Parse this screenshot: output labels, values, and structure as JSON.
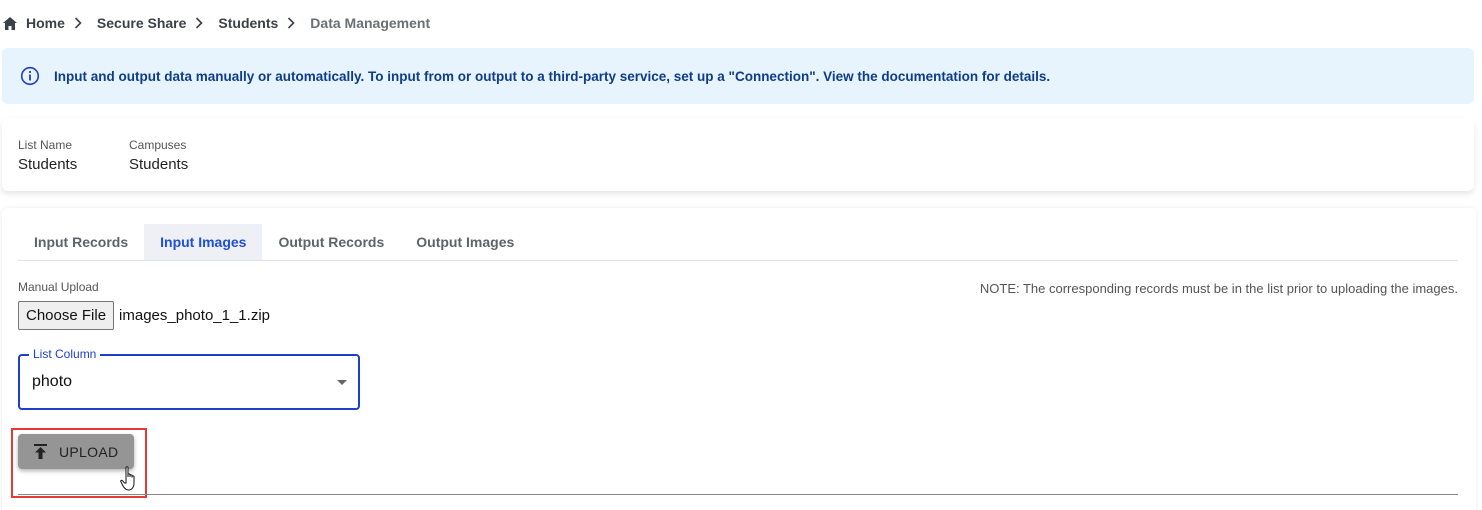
{
  "breadcrumb": {
    "items": [
      "Home",
      "Secure Share",
      "Students"
    ],
    "current": "Data Management"
  },
  "banner": {
    "text": "Input and output data manually or automatically. To input from or output to a third-party service, set up a \"Connection\". View the documentation for details."
  },
  "list_info": {
    "list_name_label": "List Name",
    "list_name_value": "Students",
    "campuses_label": "Campuses",
    "campuses_value": "Students"
  },
  "tabs": [
    {
      "label": "Input Records",
      "active": false
    },
    {
      "label": "Input Images",
      "active": true
    },
    {
      "label": "Output Records",
      "active": false
    },
    {
      "label": "Output Images",
      "active": false
    }
  ],
  "upload": {
    "manual_label": "Manual Upload",
    "note": "NOTE: The corresponding records must be in the list prior to uploading the images.",
    "choose_file_label": "Choose File",
    "file_name": "images_photo_1_1.zip",
    "list_column_label": "List Column",
    "list_column_value": "photo",
    "upload_button_label": "UPLOAD"
  },
  "icons": {
    "home": "home-icon",
    "separator": "chevron-right-icon",
    "info": "info-circle-icon",
    "upload": "upload-icon",
    "dropdown": "caret-down-icon",
    "cursor": "hand-pointer-icon"
  },
  "colors": {
    "accent": "#1e3fc8",
    "banner_bg": "#e8f4fd",
    "banner_text": "#0d3c8a",
    "highlight": "#e53935"
  }
}
